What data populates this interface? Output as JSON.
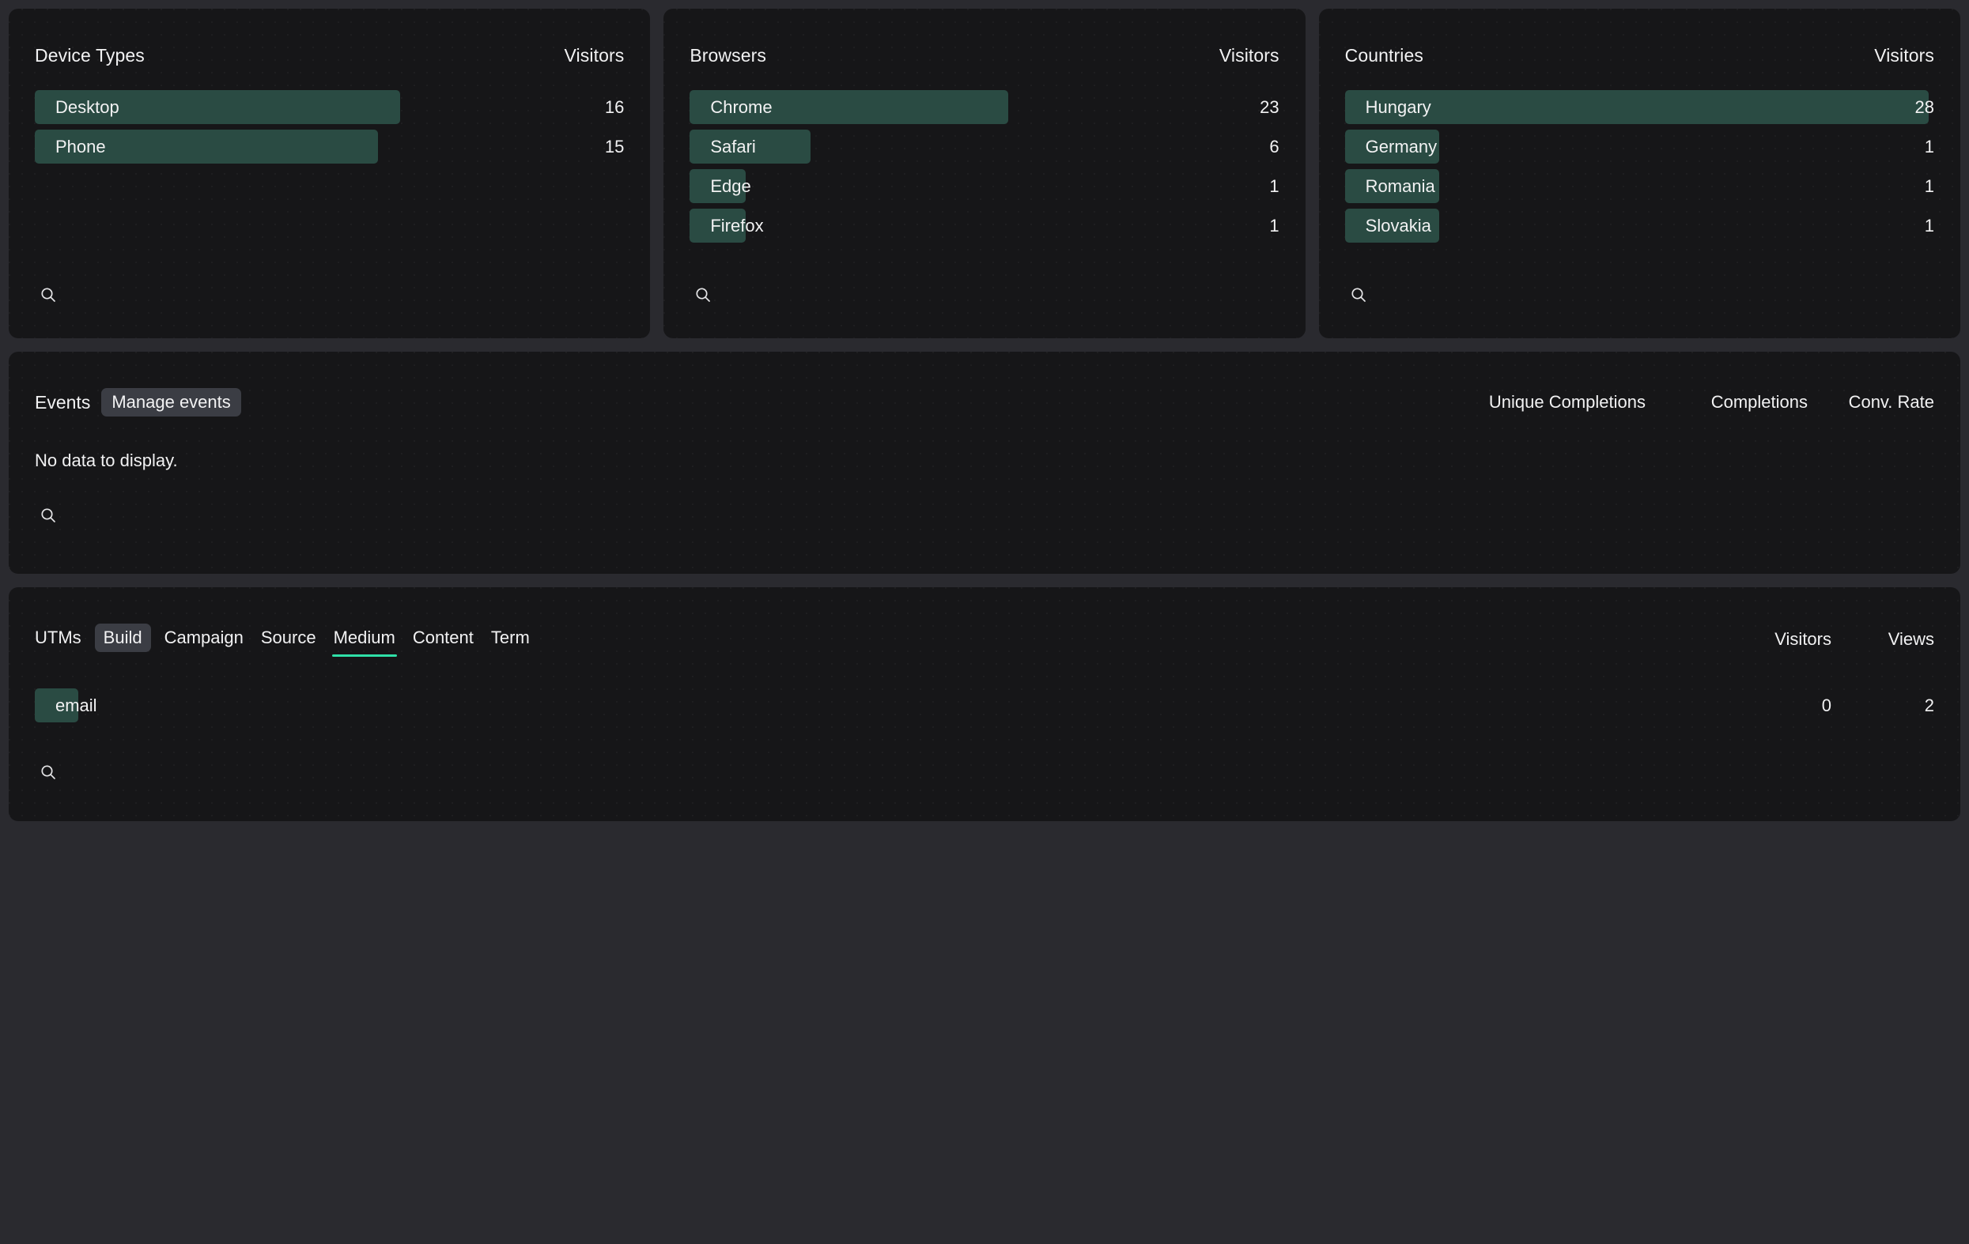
{
  "theme": {
    "page_bg": "#2a2a2f",
    "card_bg": "#161618",
    "bar_fill": "#2a4b43",
    "accent": "#2fe0a8",
    "pill_bg": "#3b3d44",
    "text": "#f2f2f3"
  },
  "panels": [
    {
      "title": "Device Types",
      "metric_header": "Visitors",
      "search_icon": "search-icon",
      "rows": [
        {
          "label": "Desktop",
          "value": "16",
          "pct": 100
        },
        {
          "label": "Phone",
          "value": "15",
          "pct": 93.75
        }
      ]
    },
    {
      "title": "Browsers",
      "metric_header": "Visitors",
      "search_icon": "search-icon",
      "rows": [
        {
          "label": "Chrome",
          "value": "23",
          "pct": 100
        },
        {
          "label": "Safari",
          "value": "6",
          "pct": 26.1
        },
        {
          "label": "Edge",
          "value": "1",
          "pct": 4.35
        },
        {
          "label": "Firefox",
          "value": "1",
          "pct": 4.35
        }
      ]
    },
    {
      "title": "Countries",
      "metric_header": "Visitors",
      "search_icon": "search-icon",
      "rows": [
        {
          "label": "Hungary",
          "value": "28",
          "pct": 100
        },
        {
          "label": "Germany",
          "value": "1",
          "pct": 3.57
        },
        {
          "label": "Romania",
          "value": "1",
          "pct": 3.57
        },
        {
          "label": "Slovakia",
          "value": "1",
          "pct": 3.57
        }
      ]
    }
  ],
  "events": {
    "title": "Events",
    "manage_label": "Manage events",
    "columns": [
      "Unique Completions",
      "Completions",
      "Conv. Rate"
    ],
    "empty_message": "No data to display.",
    "search_icon": "search-icon"
  },
  "utms": {
    "title": "UTMs",
    "tabs": [
      "Build",
      "Campaign",
      "Source",
      "Medium",
      "Content",
      "Term"
    ],
    "boxed_tab": "Build",
    "active_tab": "Medium",
    "columns": [
      "Visitors",
      "Views"
    ],
    "rows": [
      {
        "label": "email",
        "visitors": "0",
        "views": "2",
        "pct": 5.5
      }
    ],
    "search_icon": "search-icon"
  },
  "chart_data": [
    {
      "type": "bar",
      "title": "Device Types",
      "xlabel": "Visitors",
      "ylabel": "",
      "categories": [
        "Desktop",
        "Phone"
      ],
      "values": [
        16,
        15
      ],
      "orientation": "horizontal",
      "grid": false,
      "legend": "none",
      "xlim": [
        0,
        16
      ]
    },
    {
      "type": "bar",
      "title": "Browsers",
      "xlabel": "Visitors",
      "ylabel": "",
      "categories": [
        "Chrome",
        "Safari",
        "Edge",
        "Firefox"
      ],
      "values": [
        23,
        6,
        1,
        1
      ],
      "orientation": "horizontal",
      "grid": false,
      "legend": "none",
      "xlim": [
        0,
        23
      ]
    },
    {
      "type": "bar",
      "title": "Countries",
      "xlabel": "Visitors",
      "ylabel": "",
      "categories": [
        "Hungary",
        "Germany",
        "Romania",
        "Slovakia"
      ],
      "values": [
        28,
        1,
        1,
        1
      ],
      "orientation": "horizontal",
      "grid": false,
      "legend": "none",
      "xlim": [
        0,
        28
      ]
    },
    {
      "type": "table",
      "title": "UTMs - Medium",
      "columns": [
        "Medium",
        "Visitors",
        "Views"
      ],
      "rows": [
        [
          "email",
          0,
          2
        ]
      ]
    }
  ]
}
